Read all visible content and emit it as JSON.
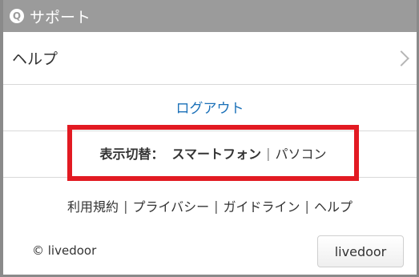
{
  "header": {
    "icon": "q-circle-icon",
    "icon_glyph": "Q",
    "title": "サポート"
  },
  "help_row": {
    "label": "ヘルプ",
    "icon": "chevron-right-icon"
  },
  "logout": {
    "label": "ログアウト"
  },
  "display_switch": {
    "label": "表示切替：",
    "current": "スマートフォン",
    "separator": "|",
    "pc": "パソコン"
  },
  "footer_links": {
    "terms": "利用規約",
    "privacy": "プライバシー",
    "guidelines": "ガイドライン",
    "help": "ヘルプ",
    "separator": "|"
  },
  "copyright": "© livedoor",
  "livedoor_button": "livedoor",
  "colors": {
    "header_bg": "#9b9b9b",
    "link": "#1a70b8",
    "highlight": "#e21a22"
  }
}
